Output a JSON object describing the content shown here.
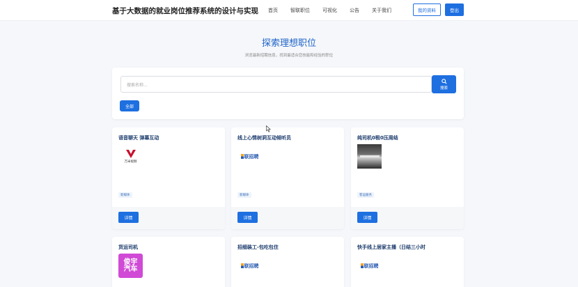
{
  "header": {
    "title": "基于大数据的就业岗位推荐系统的设计与实现",
    "nav": [
      "首页",
      "智联职位",
      "可视化",
      "公告",
      "关于我们"
    ],
    "profile_label": "我的资料",
    "logout_label": "登出"
  },
  "hero": {
    "title": "探索理想职位",
    "subtitle": "浏览最新招聘信息，找到最适合您技能和经验的职位"
  },
  "search": {
    "placeholder": "搜索名称...",
    "button_label": "搜索",
    "filter_label": "全部"
  },
  "jobs": [
    {
      "title": "语音聊天 弹幕互动",
      "logo": "万米视频",
      "tag": "新媒体",
      "detail": "详情"
    },
    {
      "title": "线上心情树洞互动倾听员",
      "logo": "联招聘",
      "tag": "新媒体",
      "detail": "详情"
    },
    {
      "title": "纯司机0租0压周结",
      "logo": "photo",
      "tag": "客运服务",
      "detail": "详情"
    },
    {
      "title": "货运司机",
      "logo": "俊宇汽车",
      "logo_line1": "俊宇",
      "logo_line2": "汽车"
    },
    {
      "title": "招细装工-包吃包住",
      "logo": "联招聘"
    },
    {
      "title": "快手线上居家主播（日结三小时",
      "logo": "联招聘"
    }
  ],
  "colors": {
    "primary": "#1e6fe0",
    "title_blue": "#1e63c8",
    "card_title": "#1a3a6b"
  }
}
